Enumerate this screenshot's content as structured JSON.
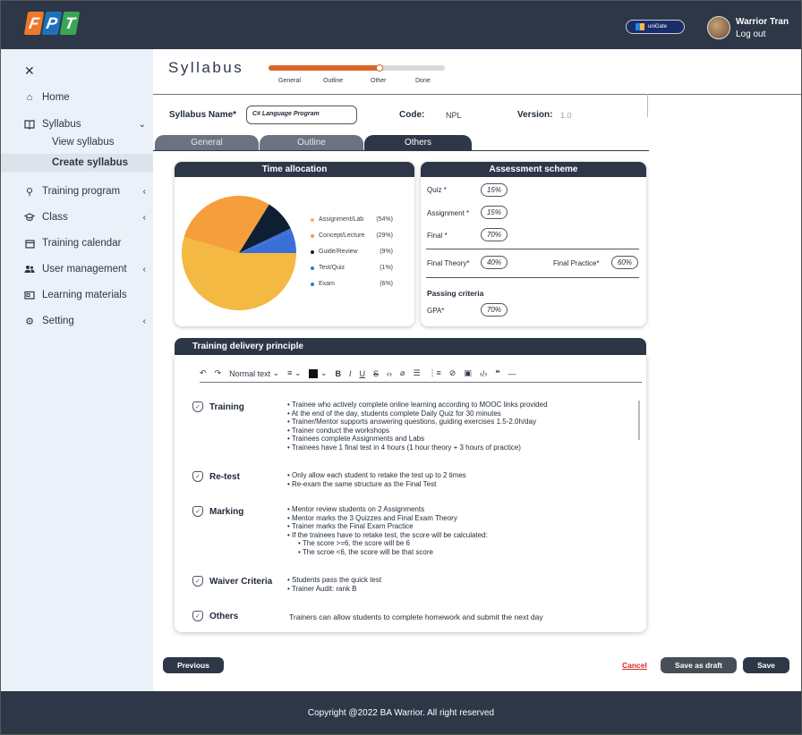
{
  "header": {
    "logo_letters": [
      "F",
      "P",
      "T"
    ],
    "unigate_label": "uniGate",
    "user_name": "Warrior Tran",
    "logout_label": "Log out"
  },
  "sidebar": {
    "items": [
      {
        "label": "Home",
        "icon": "home-icon"
      },
      {
        "label": "Syllabus",
        "icon": "book-icon"
      },
      {
        "label": "Training program",
        "icon": "presenter-icon"
      },
      {
        "label": "Class",
        "icon": "graduation-cap-icon"
      },
      {
        "label": "Training calendar",
        "icon": "calendar-icon"
      },
      {
        "label": "User management",
        "icon": "users-icon"
      },
      {
        "label": "Learning materials",
        "icon": "folder-icon"
      },
      {
        "label": "Setting",
        "icon": "gear-icon"
      }
    ],
    "syllabus_sub": [
      "View syllabus",
      "Create syllabus"
    ],
    "active_sub": "Create syllabus"
  },
  "page": {
    "title": "Syllabus",
    "steps": [
      "General",
      "Outline",
      "Other",
      "Done"
    ],
    "progress": 0.63
  },
  "form": {
    "name_label": "Syllabus Name*",
    "name_value": "C# Language Program",
    "code_label": "Code:",
    "code_value": "NPL",
    "version_label": "Version:",
    "version_value": "1.0"
  },
  "tabs": [
    {
      "label": "General",
      "active": false
    },
    {
      "label": "Outline",
      "active": false
    },
    {
      "label": "Others",
      "active": true
    }
  ],
  "time_allocation": {
    "title": "Time allocation",
    "legend": [
      {
        "label": "Assignment/Lab",
        "pct": "(54%)",
        "color": "#f4b942"
      },
      {
        "label": "Concept/Lecture",
        "pct": "(29%)",
        "color": "#f59e3b"
      },
      {
        "label": "Guide/Review",
        "pct": "(9%)",
        "color": "#0f1f33"
      },
      {
        "label": "Test/Quiz",
        "pct": "(1%)",
        "color": "#3b6fd8"
      },
      {
        "label": "Exam",
        "pct": "(6%)",
        "color": "#3b6fd8"
      }
    ]
  },
  "chart_data": {
    "type": "pie",
    "slices": [
      {
        "label": "Assignment/Lab",
        "value": 54,
        "color": "#f4b942"
      },
      {
        "label": "Concept/Lecture",
        "value": 29,
        "color": "#f59e3b"
      },
      {
        "label": "Guide/Review",
        "value": 9,
        "color": "#0f1f33"
      },
      {
        "label": "Test/Quiz",
        "value": 1,
        "color": "#3b6fd8"
      },
      {
        "label": "Exam",
        "value": 6,
        "color": "#3b6fd8"
      }
    ]
  },
  "assessment": {
    "title": "Assessment scheme",
    "quiz_label": "Quiz *",
    "quiz_value": "15%",
    "assignment_label": "Assignment *",
    "assignment_value": "15%",
    "final_label": "Final *",
    "final_value": "70%",
    "final_theory_label": "Final Theory*",
    "final_theory_value": "40%",
    "final_practice_label": "Final Practice*",
    "final_practice_value": "60%",
    "passing_label": "Passing criteria",
    "gpa_label": "GPA*",
    "gpa_value": "70%"
  },
  "delivery": {
    "title": "Training delivery principle",
    "toolbar_text_style": "Normal text",
    "sections": [
      {
        "title": "Training",
        "bullets": [
          "Trainee who actively complete online learning according to MOOC links provided",
          "At the end of the day, students complete Daily Quiz for 30 minutes",
          "Trainer/Mentor supports answering questions, guiding exercises 1.5-2.0h/day",
          "Trainer conduct the workshops",
          "Trainees complete Assignments and Labs",
          "Trainees have 1 final test in 4 hours (1 hour theory + 3 hours of practice)"
        ]
      },
      {
        "title": "Re-test",
        "bullets": [
          "Only allow each student to retake the test up to 2 times",
          "Re-exam the same structure as the Final Test"
        ]
      },
      {
        "title": "Marking",
        "bullets": [
          "Mentor review students on 2 Assignments",
          "Mentor marks the 3 Quizzes and Final Exam Theory",
          "Trainer marks the Final Exam Practice",
          "If the trainees have to retake test, the score will be calculated:"
        ],
        "sub_bullets": [
          "The score >=6, the score will be 6",
          "The scroe <6, the score will be that score"
        ]
      },
      {
        "title": "Waiver Criteria",
        "bullets": [
          "Students pass the quick test",
          "Trainer Audit: rank B"
        ]
      },
      {
        "title": "Others",
        "text": "Trainers can allow students to complete homework and submit the next day"
      }
    ]
  },
  "actions": {
    "previous": "Previous",
    "cancel": "Cancel",
    "save_draft": "Save as draft",
    "save": "Save"
  },
  "footer": {
    "copyright": "Copyright @2022 BA Warrior. All right reserved"
  }
}
